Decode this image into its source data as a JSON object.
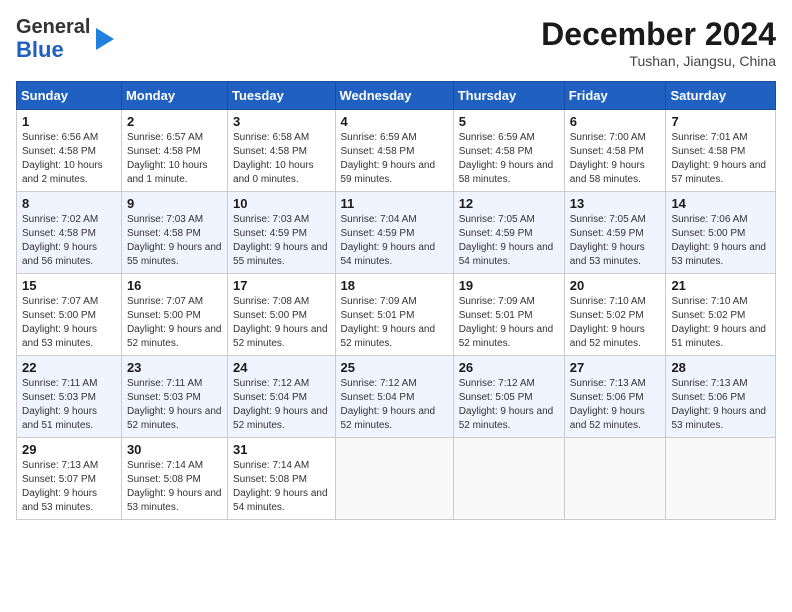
{
  "header": {
    "logo_general": "General",
    "logo_blue": "Blue",
    "month_title": "December 2024",
    "location": "Tushan, Jiangsu, China"
  },
  "columns": [
    "Sunday",
    "Monday",
    "Tuesday",
    "Wednesday",
    "Thursday",
    "Friday",
    "Saturday"
  ],
  "weeks": [
    [
      {
        "day": "1",
        "sunrise": "6:56 AM",
        "sunset": "4:58 PM",
        "daylight": "10 hours and 2 minutes."
      },
      {
        "day": "2",
        "sunrise": "6:57 AM",
        "sunset": "4:58 PM",
        "daylight": "10 hours and 1 minute."
      },
      {
        "day": "3",
        "sunrise": "6:58 AM",
        "sunset": "4:58 PM",
        "daylight": "10 hours and 0 minutes."
      },
      {
        "day": "4",
        "sunrise": "6:59 AM",
        "sunset": "4:58 PM",
        "daylight": "9 hours and 59 minutes."
      },
      {
        "day": "5",
        "sunrise": "6:59 AM",
        "sunset": "4:58 PM",
        "daylight": "9 hours and 58 minutes."
      },
      {
        "day": "6",
        "sunrise": "7:00 AM",
        "sunset": "4:58 PM",
        "daylight": "9 hours and 58 minutes."
      },
      {
        "day": "7",
        "sunrise": "7:01 AM",
        "sunset": "4:58 PM",
        "daylight": "9 hours and 57 minutes."
      }
    ],
    [
      {
        "day": "8",
        "sunrise": "7:02 AM",
        "sunset": "4:58 PM",
        "daylight": "9 hours and 56 minutes."
      },
      {
        "day": "9",
        "sunrise": "7:03 AM",
        "sunset": "4:58 PM",
        "daylight": "9 hours and 55 minutes."
      },
      {
        "day": "10",
        "sunrise": "7:03 AM",
        "sunset": "4:59 PM",
        "daylight": "9 hours and 55 minutes."
      },
      {
        "day": "11",
        "sunrise": "7:04 AM",
        "sunset": "4:59 PM",
        "daylight": "9 hours and 54 minutes."
      },
      {
        "day": "12",
        "sunrise": "7:05 AM",
        "sunset": "4:59 PM",
        "daylight": "9 hours and 54 minutes."
      },
      {
        "day": "13",
        "sunrise": "7:05 AM",
        "sunset": "4:59 PM",
        "daylight": "9 hours and 53 minutes."
      },
      {
        "day": "14",
        "sunrise": "7:06 AM",
        "sunset": "5:00 PM",
        "daylight": "9 hours and 53 minutes."
      }
    ],
    [
      {
        "day": "15",
        "sunrise": "7:07 AM",
        "sunset": "5:00 PM",
        "daylight": "9 hours and 53 minutes."
      },
      {
        "day": "16",
        "sunrise": "7:07 AM",
        "sunset": "5:00 PM",
        "daylight": "9 hours and 52 minutes."
      },
      {
        "day": "17",
        "sunrise": "7:08 AM",
        "sunset": "5:00 PM",
        "daylight": "9 hours and 52 minutes."
      },
      {
        "day": "18",
        "sunrise": "7:09 AM",
        "sunset": "5:01 PM",
        "daylight": "9 hours and 52 minutes."
      },
      {
        "day": "19",
        "sunrise": "7:09 AM",
        "sunset": "5:01 PM",
        "daylight": "9 hours and 52 minutes."
      },
      {
        "day": "20",
        "sunrise": "7:10 AM",
        "sunset": "5:02 PM",
        "daylight": "9 hours and 52 minutes."
      },
      {
        "day": "21",
        "sunrise": "7:10 AM",
        "sunset": "5:02 PM",
        "daylight": "9 hours and 51 minutes."
      }
    ],
    [
      {
        "day": "22",
        "sunrise": "7:11 AM",
        "sunset": "5:03 PM",
        "daylight": "9 hours and 51 minutes."
      },
      {
        "day": "23",
        "sunrise": "7:11 AM",
        "sunset": "5:03 PM",
        "daylight": "9 hours and 52 minutes."
      },
      {
        "day": "24",
        "sunrise": "7:12 AM",
        "sunset": "5:04 PM",
        "daylight": "9 hours and 52 minutes."
      },
      {
        "day": "25",
        "sunrise": "7:12 AM",
        "sunset": "5:04 PM",
        "daylight": "9 hours and 52 minutes."
      },
      {
        "day": "26",
        "sunrise": "7:12 AM",
        "sunset": "5:05 PM",
        "daylight": "9 hours and 52 minutes."
      },
      {
        "day": "27",
        "sunrise": "7:13 AM",
        "sunset": "5:06 PM",
        "daylight": "9 hours and 52 minutes."
      },
      {
        "day": "28",
        "sunrise": "7:13 AM",
        "sunset": "5:06 PM",
        "daylight": "9 hours and 53 minutes."
      }
    ],
    [
      {
        "day": "29",
        "sunrise": "7:13 AM",
        "sunset": "5:07 PM",
        "daylight": "9 hours and 53 minutes."
      },
      {
        "day": "30",
        "sunrise": "7:14 AM",
        "sunset": "5:08 PM",
        "daylight": "9 hours and 53 minutes."
      },
      {
        "day": "31",
        "sunrise": "7:14 AM",
        "sunset": "5:08 PM",
        "daylight": "9 hours and 54 minutes."
      },
      null,
      null,
      null,
      null
    ]
  ],
  "labels": {
    "sunrise": "Sunrise:",
    "sunset": "Sunset:",
    "daylight": "Daylight hours"
  }
}
